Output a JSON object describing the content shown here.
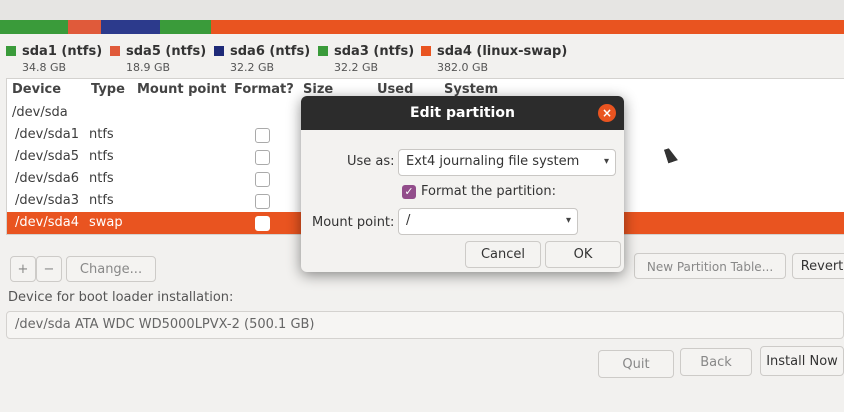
{
  "partition_bar": [
    {
      "name": "sda1",
      "color": "#3a9b3a",
      "share": 8
    },
    {
      "name": "sda5",
      "color": "#e05a3a",
      "share": 4
    },
    {
      "name": "sda6",
      "color": "#2c3a8c",
      "share": 7
    },
    {
      "name": "sda3",
      "color": "#3a9b3a",
      "share": 6
    },
    {
      "name": "sda4",
      "color": "#e95420",
      "share": 75
    }
  ],
  "legend": [
    {
      "label": "sda1 (ntfs)",
      "size": "34.8 GB",
      "color": "#3a9b3a"
    },
    {
      "label": "sda5 (ntfs)",
      "size": "18.9 GB",
      "color": "#e05a3a"
    },
    {
      "label": "sda6 (ntfs)",
      "size": "32.2 GB",
      "color": "#1e2a78"
    },
    {
      "label": "sda3 (ntfs)",
      "size": "32.2 GB",
      "color": "#3a9b3a"
    },
    {
      "label": "sda4 (linux-swap)",
      "size": "382.0 GB",
      "color": "#e95420"
    }
  ],
  "table": {
    "headers": {
      "device": "Device",
      "type": "Type",
      "mount": "Mount point",
      "format": "Format?",
      "size": "Size",
      "used": "Used",
      "system": "System"
    },
    "rows": [
      {
        "device": "/dev/sda",
        "type": ""
      },
      {
        "device": "/dev/sda1",
        "type": "ntfs"
      },
      {
        "device": "/dev/sda5",
        "type": "ntfs"
      },
      {
        "device": "/dev/sda6",
        "type": "ntfs"
      },
      {
        "device": "/dev/sda3",
        "type": "ntfs"
      },
      {
        "device": "/dev/sda4",
        "type": "swap"
      }
    ]
  },
  "controls": {
    "add": "+",
    "remove": "−",
    "change": "Change...",
    "new_table": "New Partition Table...",
    "revert": "Revert"
  },
  "boot": {
    "label": "Device for boot loader installation:",
    "value": "/dev/sda   ATA WDC WD5000LPVX-2 (500.1 GB)"
  },
  "footer": {
    "quit": "Quit",
    "back": "Back",
    "install": "Install Now"
  },
  "dialog": {
    "title": "Edit partition",
    "close": "×",
    "use_as_label": "Use as:",
    "use_as_value": "Ext4 journaling file system",
    "format_label": "Format the partition:",
    "format_checked": "✓",
    "mount_label": "Mount point:",
    "mount_value": "/",
    "cancel": "Cancel",
    "ok": "OK"
  },
  "icons": {
    "dropdown": "▾"
  }
}
